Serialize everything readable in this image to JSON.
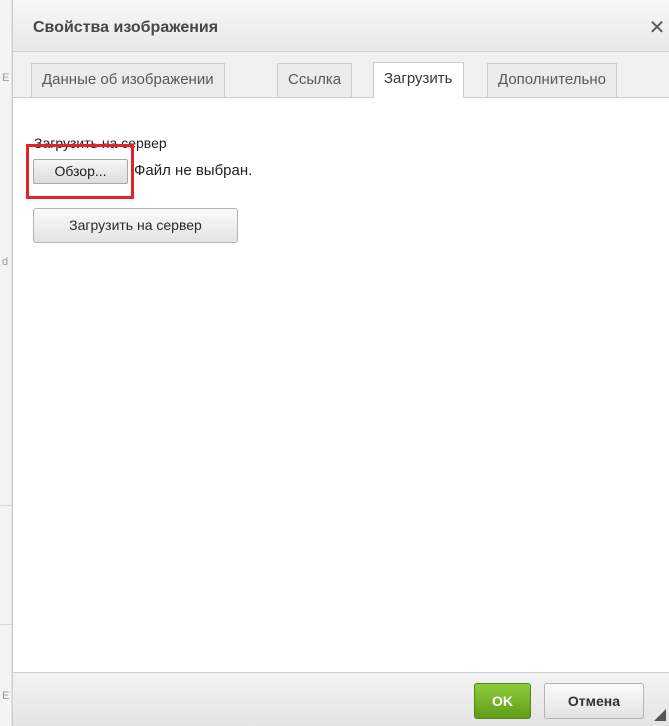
{
  "dialog": {
    "title": "Свойства изображения",
    "close_symbol": "✕"
  },
  "tabs": [
    {
      "label": "Данные об изображении",
      "active": false
    },
    {
      "label": "Ссылка",
      "active": false
    },
    {
      "label": "Загрузить",
      "active": true
    },
    {
      "label": "Дополнительно",
      "active": false
    }
  ],
  "upload": {
    "label": "Загрузить на сервер",
    "browse_button": "Обзор...",
    "file_status": "Файл не выбран.",
    "submit_button": "Загрузить на сервер"
  },
  "footer": {
    "ok_button": "OK",
    "cancel_button": "Отмена"
  },
  "background_fragments": [
    "Е",
    "d",
    "Е"
  ],
  "colors": {
    "highlight": "#e3232c",
    "ok_green": "#6aab1e"
  }
}
